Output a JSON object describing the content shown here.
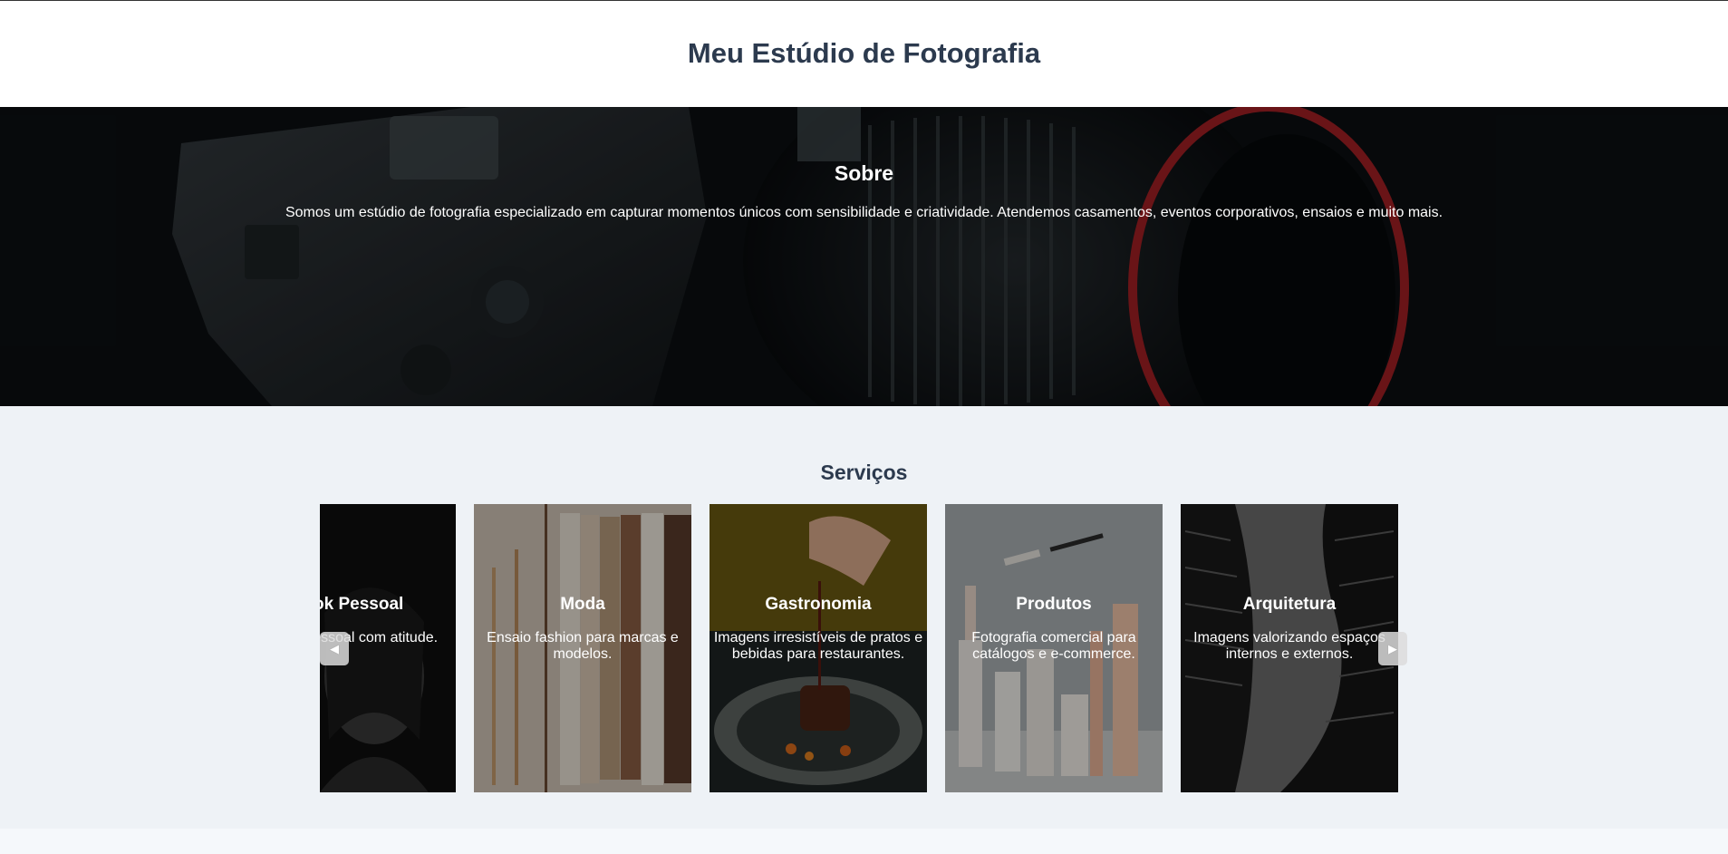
{
  "header": {
    "title": "Meu Estúdio de Fotografia"
  },
  "about": {
    "title": "Sobre",
    "text": "Somos um estúdio de fotografia especializado em capturar momentos únicos com sensibilidade e criatividade. Atendemos casamentos, eventos corporativos, ensaios e muito mais."
  },
  "services": {
    "title": "Serviços",
    "cards": [
      {
        "title": "Book Pessoal",
        "desc": "Ensaio pessoal com atitude."
      },
      {
        "title": "Moda",
        "desc": "Ensaio fashion para marcas e modelos."
      },
      {
        "title": "Gastronomia",
        "desc": "Imagens irresistíveis de pratos e bebidas para restaurantes."
      },
      {
        "title": "Produtos",
        "desc": "Fotografia comercial para catálogos e e-commerce."
      },
      {
        "title": "Arquitetura",
        "desc": "Imagens valorizando espaços internos e externos."
      }
    ],
    "prev_icon": "◀",
    "next_icon": "▶"
  }
}
